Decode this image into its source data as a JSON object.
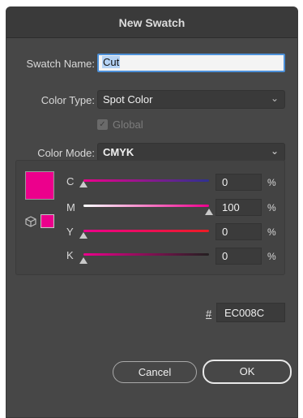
{
  "dialog": {
    "title": "New Swatch"
  },
  "swatch_name": {
    "label": "Swatch Name:",
    "value": "Cut"
  },
  "color_type": {
    "label": "Color Type:",
    "value": "Spot Color"
  },
  "global": {
    "label": "Global",
    "checked": true,
    "enabled": false
  },
  "color_mode": {
    "label": "Color Mode:",
    "value": "CMYK"
  },
  "swatch_color": "#EC008C",
  "channels": [
    {
      "label": "C",
      "value": "0",
      "unit": "%",
      "level": 0
    },
    {
      "label": "M",
      "value": "100",
      "unit": "%",
      "level": 100
    },
    {
      "label": "Y",
      "value": "0",
      "unit": "%",
      "level": 0
    },
    {
      "label": "K",
      "value": "0",
      "unit": "%",
      "level": 0
    }
  ],
  "hex": {
    "label": "#",
    "value": "EC008C"
  },
  "buttons": {
    "cancel": "Cancel",
    "ok": "OK"
  },
  "icons": {
    "dropdown": "chevron-down-icon",
    "checkbox": "checkmark-icon",
    "gamut": "cube-icon"
  }
}
